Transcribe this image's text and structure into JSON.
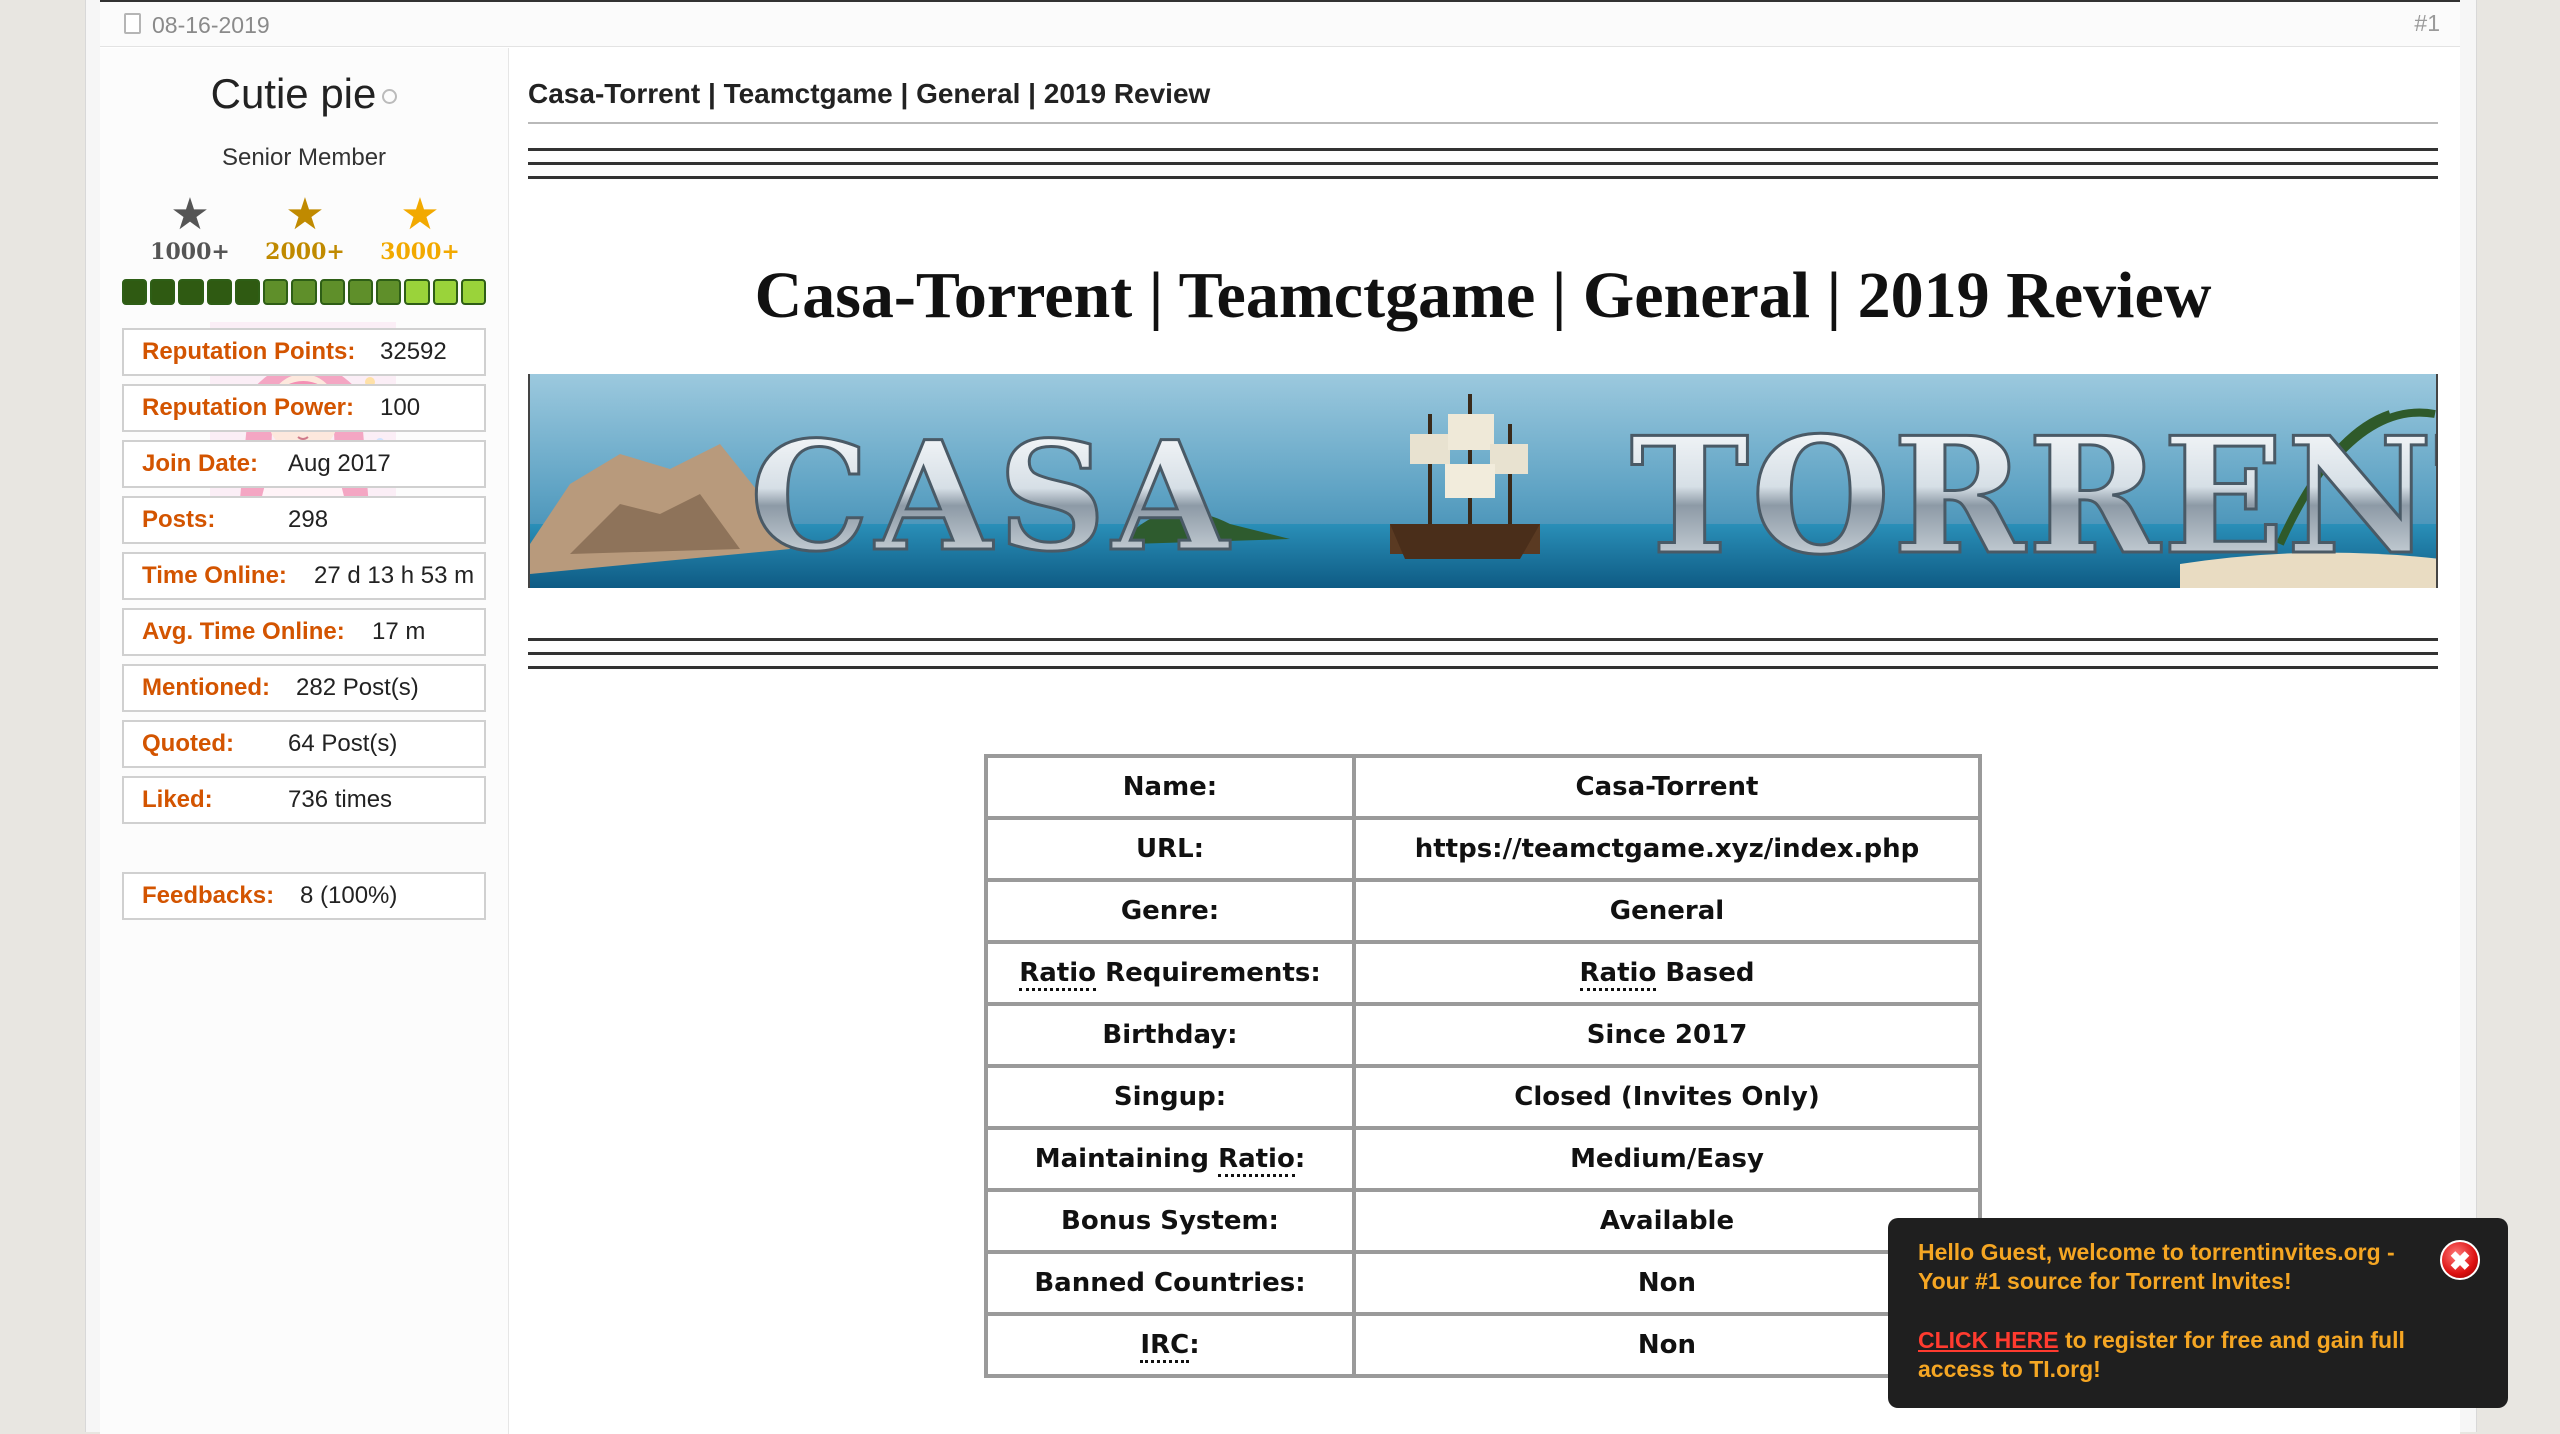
{
  "post": {
    "date": "08-16-2019",
    "number": "#1"
  },
  "user": {
    "name": "Cutie pie",
    "title": "Senior Member",
    "awards": [
      {
        "label": "1000+",
        "color": "#555555"
      },
      {
        "label": "2000+",
        "color": "#c08a00"
      },
      {
        "label": "3000+",
        "color": "#f2a900"
      }
    ],
    "reputation_bar": {
      "segments": 13,
      "colors": [
        "#2f5a12",
        "#2f5a12",
        "#2f5a12",
        "#2f5a12",
        "#2f5a12",
        "#5f8f2a",
        "#5f8f2a",
        "#5f8f2a",
        "#5f8f2a",
        "#5f8f2a",
        "#9ad33a",
        "#9ad33a",
        "#9ad33a"
      ]
    },
    "stats": [
      {
        "key": "Reputation Points:",
        "value": "32592"
      },
      {
        "key": "Reputation Power:",
        "value": "100"
      },
      {
        "key": "Join Date:",
        "value": "Aug 2017"
      },
      {
        "key": "Posts:",
        "value": "298"
      },
      {
        "key": "Time Online:",
        "value": "27 d 13 h 53 m"
      },
      {
        "key": "Avg. Time Online:",
        "value": "17 m"
      },
      {
        "key": "Mentioned:",
        "value": "282 Post(s)"
      },
      {
        "key": "Quoted:",
        "value": "64 Post(s)"
      },
      {
        "key": "Liked:",
        "value": "736 times"
      }
    ],
    "feedbacks": {
      "key": "Feedbacks:",
      "value": "8 (100%)"
    }
  },
  "content": {
    "post_title": "Casa-Torrent | Teamctgame | General | 2019 Review",
    "big_title": "Casa-Torrent | Teamctgame | General | 2019 Review",
    "banner_text": {
      "casa": "CASA",
      "torrent": "TORRENT"
    },
    "table": [
      {
        "label": "Name:",
        "value": "Casa-Torrent"
      },
      {
        "label": "URL:",
        "value": "https://teamctgame.xyz/index.php"
      },
      {
        "label": "Genre:",
        "value": "General"
      },
      {
        "label_pre": "",
        "label_abbr": "Ratio",
        "label_post": " Requirements:",
        "value_abbr": "Ratio",
        "value_post": " Based"
      },
      {
        "label": "Birthday:",
        "value": "Since 2017"
      },
      {
        "label": "Singup:",
        "value": "Closed (Invites Only)"
      },
      {
        "label_pre": "Maintaining ",
        "label_abbr": "Ratio",
        "label_post": ":",
        "value": "Medium/Easy"
      },
      {
        "label": "Bonus System:",
        "value": "Available"
      },
      {
        "label": "Banned Countries:",
        "value": "Non"
      },
      {
        "label_pre": "",
        "label_abbr": "IRC",
        "label_post": ":",
        "value": "Non"
      }
    ]
  },
  "toast": {
    "line1": "Hello Guest, welcome to torrentinvites.org - Your #1 source for Torrent Invites!",
    "cta": "CLICK HERE",
    "line2": " to register for free and gain full access to TI.org!",
    "close_symbol": "✖"
  },
  "colors": {
    "accent_label": "#d35400",
    "toast_text": "#f5a623",
    "toast_link": "#ff3b2f",
    "toast_bg": "#1f1f1f"
  }
}
